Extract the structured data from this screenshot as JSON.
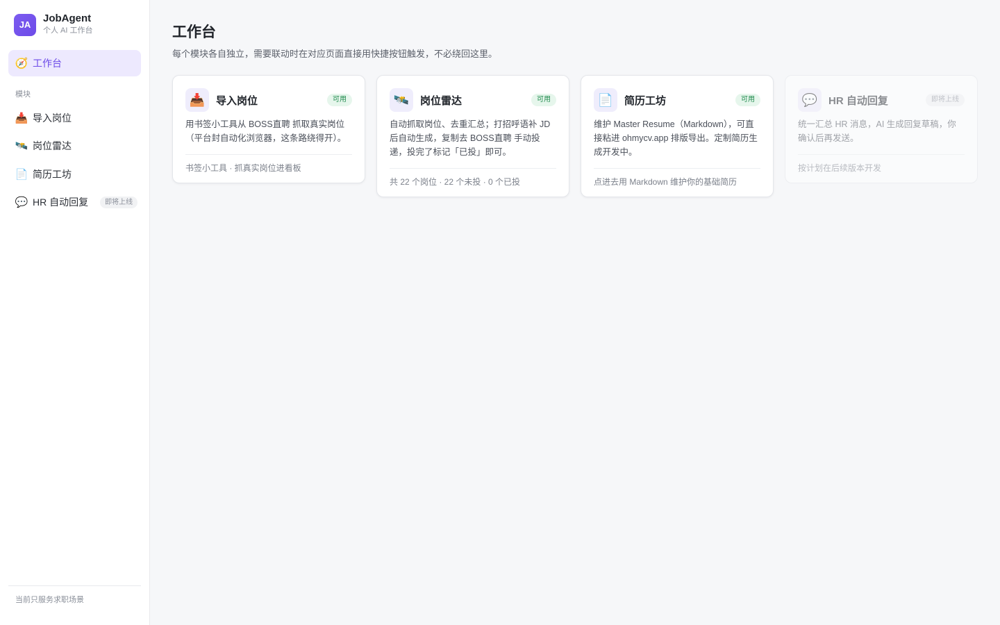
{
  "brand": {
    "logo": "JA",
    "name": "JobAgent",
    "subtitle": "个人 AI 工作台"
  },
  "sidebar": {
    "home": {
      "icon": "compass-icon",
      "emoji": "🧭",
      "label": "工作台"
    },
    "section_label": "模块",
    "items": [
      {
        "icon": "inbox-tray-icon",
        "emoji": "📥",
        "label": "导入岗位"
      },
      {
        "icon": "satellite-radar-icon",
        "emoji": "🛰️",
        "label": "岗位雷达"
      },
      {
        "icon": "document-icon",
        "emoji": "📄",
        "label": "简历工坊"
      },
      {
        "icon": "speech-bubble-icon",
        "emoji": "💬",
        "label": "HR 自动回复",
        "badge": "即将上线"
      }
    ],
    "footer": "当前只服务求职场景"
  },
  "main": {
    "title": "工作台",
    "description": "每个模块各自独立，需要联动时在对应页面直接用快捷按钮触发，不必绕回这里。",
    "cards": [
      {
        "icon": "inbox-tray-icon",
        "emoji": "📥",
        "title": "导入岗位",
        "status": "可用",
        "description": "用书签小工具从 BOSS直聘 抓取真实岗位（平台封自动化浏览器，这条路绕得开）。",
        "meta": "书签小工具 · 抓真实岗位进看板"
      },
      {
        "icon": "satellite-radar-icon",
        "emoji": "🛰️",
        "title": "岗位雷达",
        "status": "可用",
        "description": "自动抓取岗位、去重汇总；打招呼语补 JD 后自动生成，复制去 BOSS直聘 手动投递，投完了标记「已投」即可。",
        "meta": "共 22 个岗位 · 22 个未投 · 0 个已投"
      },
      {
        "icon": "document-icon",
        "emoji": "📄",
        "title": "简历工坊",
        "status": "可用",
        "description": "维护 Master Resume（Markdown），可直接粘进 ohmycv.app 排版导出。定制简历生成开发中。",
        "meta": "点进去用 Markdown 维护你的基础简历"
      },
      {
        "icon": "speech-bubble-icon",
        "emoji": "💬",
        "title": "HR 自动回复",
        "status": "即将上线",
        "description": "统一汇总 HR 消息，AI 生成回复草稿，你确认后再发送。",
        "meta": "按计划在后续版本开发"
      }
    ]
  },
  "colors": {
    "accent": "#6d4be8",
    "accent_bg": "#ede9fe",
    "ok": "#1f8a4c",
    "ok_bg": "#e6f6ec"
  }
}
